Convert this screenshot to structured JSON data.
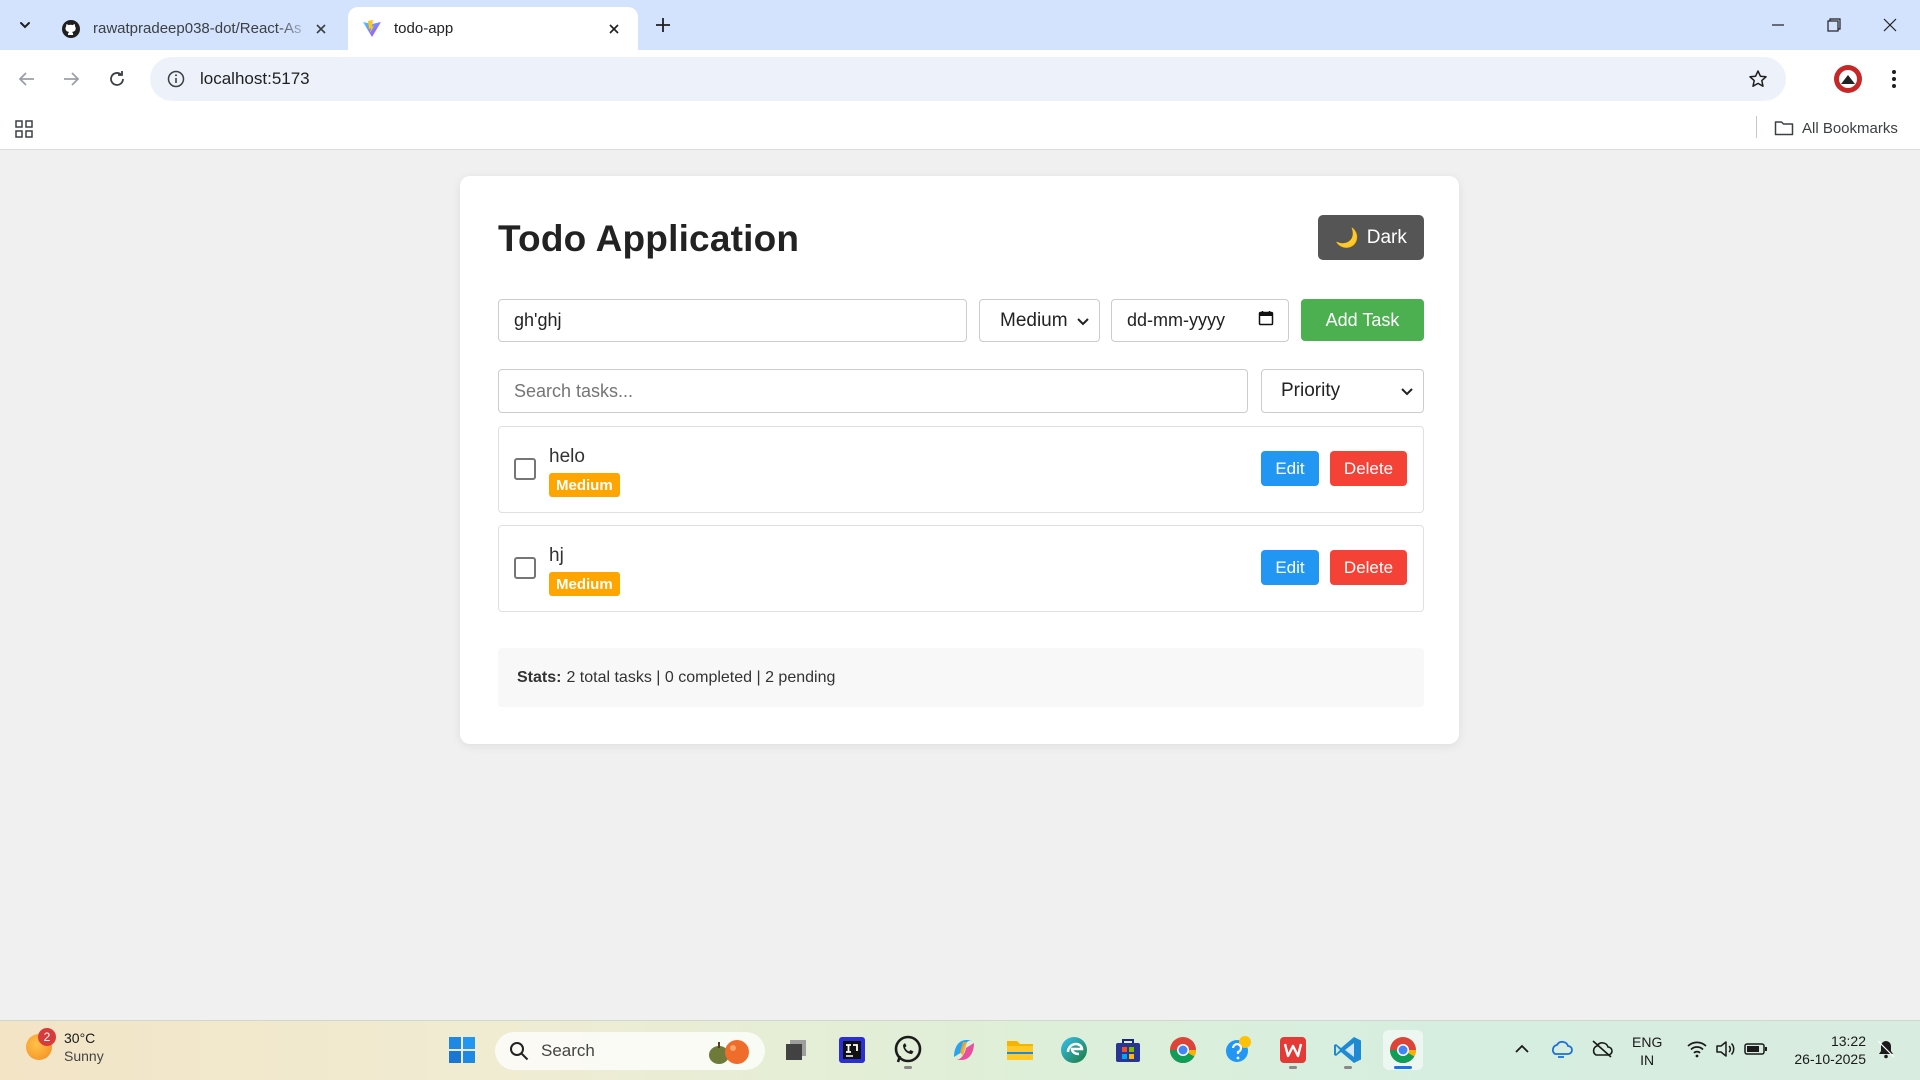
{
  "browser": {
    "tabs": [
      {
        "title": "rawatpradeep038-dot/React-As",
        "favicon": "github-icon",
        "active": false
      },
      {
        "title": "todo-app",
        "favicon": "vite-icon",
        "active": true
      }
    ],
    "url": "localhost:5173",
    "bookmarks_label": "All Bookmarks"
  },
  "app": {
    "title": "Todo Application",
    "theme_button": {
      "emoji": "🌙",
      "label": "Dark"
    },
    "task_input_value": "gh'ghj",
    "priority_select_value": "Medium",
    "date_placeholder": "dd-mm-yyyy",
    "add_button": "Add Task",
    "search_placeholder": "Search tasks...",
    "filter_select_value": "Priority",
    "tasks": [
      {
        "name": "helo",
        "priority": "Medium",
        "completed": false,
        "edit_label": "Edit",
        "delete_label": "Delete"
      },
      {
        "name": "hj",
        "priority": "Medium",
        "completed": false,
        "edit_label": "Edit",
        "delete_label": "Delete"
      }
    ],
    "stats": {
      "label": "Stats:",
      "text": "2 total tasks | 0 completed | 2 pending"
    },
    "colors": {
      "add_button": "#4caf50",
      "edit_button": "#2196f3",
      "delete_button": "#f44336",
      "priority_badge": "#ffa500",
      "dark_button": "#555555"
    }
  },
  "taskbar": {
    "weather": {
      "temp": "30°C",
      "condition": "Sunny",
      "badge": "2"
    },
    "search_label": "Search",
    "language": {
      "line1": "ENG",
      "line2": "IN"
    },
    "time": "13:22",
    "date": "26-10-2025"
  }
}
